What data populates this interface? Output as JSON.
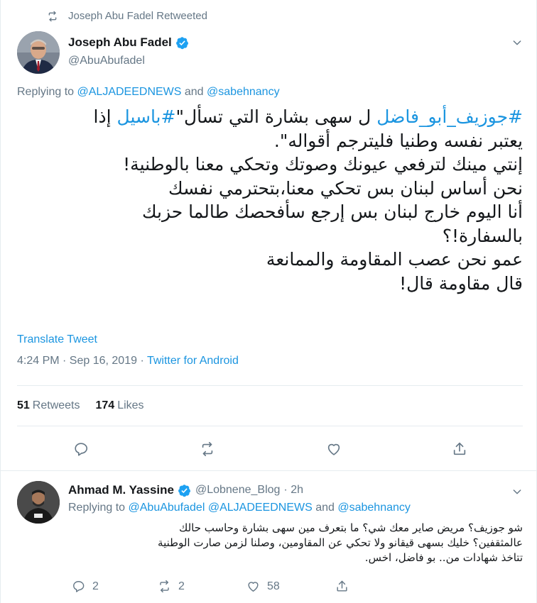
{
  "retweet_bar": {
    "text": "Joseph Abu Fadel Retweeted",
    "icon": "retweet-icon"
  },
  "main_tweet": {
    "author_name": "Joseph Abu Fadel",
    "author_handle": "@AbuAbufadel",
    "verified": true,
    "replying_prefix": "Replying to ",
    "replying_to": [
      "@ALJADEEDNEWS",
      "@sabehnancy"
    ],
    "replying_and": " and ",
    "text_lines": [
      {
        "tag1": "#جوزيف_أبو_فاضل",
        "mid": " ل سهى بشارة التي تسأل\"",
        "tag2": "#باسيل",
        "end": " إذا"
      },
      "يعتبر نفسه وطنيا فليترجم أقواله\".",
      "إنتي مينك لترفعي عيونك وصوتك وتحكي معنا بالوطنية!",
      "نحن أساس لبنان بس تحكي معنا،بتحترمي نفسك",
      "أنا اليوم خارج لبنان بس إرجع سأفحصك طالما حزبك",
      "بالسفارة!؟",
      "عمو نحن عصب المقاومة والممانعة",
      "قال مقاومة قال!"
    ],
    "translate_label": "Translate Tweet",
    "time": "4:24 PM · Sep 16, 2019 · ",
    "source": "Twitter for Android",
    "retweets_count": "51",
    "retweets_label": "Retweets",
    "likes_count": "174",
    "likes_label": "Likes"
  },
  "reply_tweet": {
    "author_name": "Ahmad M. Yassine",
    "author_handle": "@Lobnene_Blog",
    "time_ago": "· 2h",
    "verified": true,
    "replying_prefix": "Replying to ",
    "replying_to": [
      "@AbuAbufadel",
      "@ALJADEEDNEWS",
      "@sabehnancy"
    ],
    "replying_and": " and ",
    "text_lines": [
      "شو جوزيف؟ مريض صاير معك شي؟ ما بتعرف مين سهى بشارة وحاسب حالك",
      "عالمثقفين؟ خليك بسهى قيقانو ولا تحكي عن المقاومين، وصلنا لزمن صارت الوطنية",
      "تتاخذ شهادات من.. بو فاضل، اخس."
    ],
    "reply_count": "2",
    "retweet_count": "2",
    "like_count": "58"
  },
  "colors": {
    "accent": "#1b95e0",
    "muted": "#657786",
    "text": "#14171a",
    "divider": "#e6ecf0"
  }
}
